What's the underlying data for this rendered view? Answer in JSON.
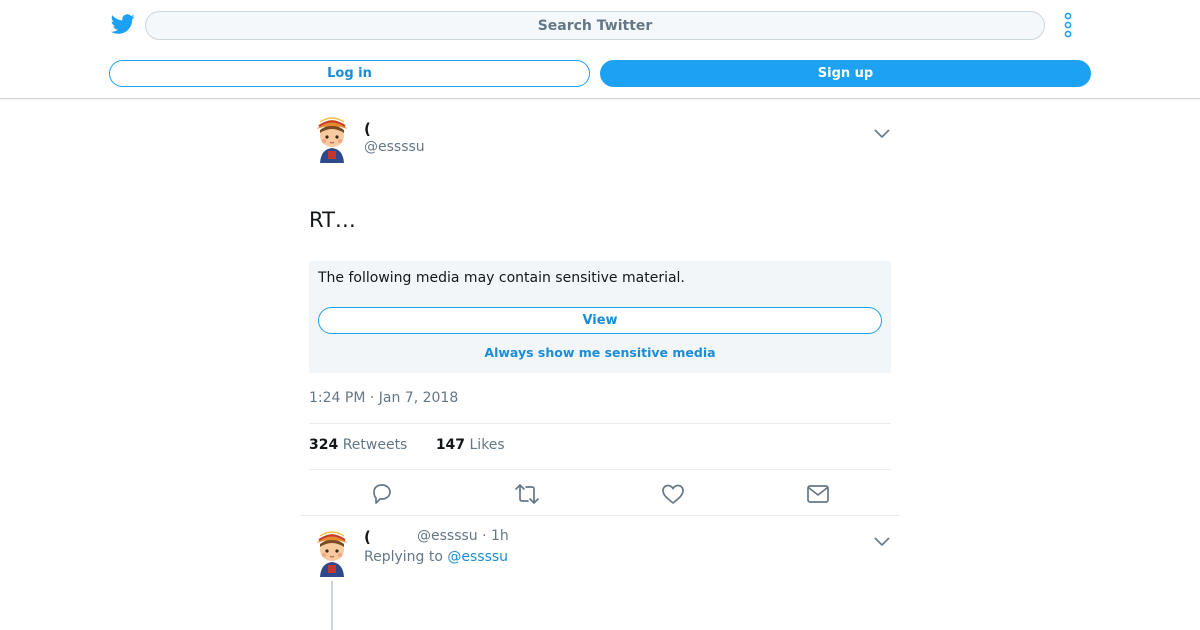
{
  "header": {
    "search_placeholder": "Search Twitter",
    "login_label": "Log in",
    "signup_label": "Sign up",
    "logo_icon": "twitter-bird-icon",
    "more_icon": "vertical-dots-icon"
  },
  "tweet": {
    "author_name": "(",
    "author_handle": "@essssu",
    "text": "RT…",
    "sensitive": {
      "message": "The following media may contain sensitive material.",
      "view_label": "View",
      "always_show_label": "Always show me sensitive media"
    },
    "timestamp": "1:24 PM · Jan 7, 2018",
    "retweets_count": "324",
    "retweets_label": "Retweets",
    "likes_count": "147",
    "likes_label": "Likes",
    "actions": [
      "reply-icon",
      "retweet-icon",
      "like-icon",
      "message-icon"
    ]
  },
  "reply": {
    "author_name": "(",
    "author_handle": "@essssu",
    "time": "· 1h",
    "replying_prefix": "Replying to",
    "replying_to": "@essssu"
  },
  "colors": {
    "brand": "#1da1f2",
    "link": "#1b8dd6",
    "secondary_text": "#657786",
    "sensitive_bg": "#f3f6f8"
  }
}
